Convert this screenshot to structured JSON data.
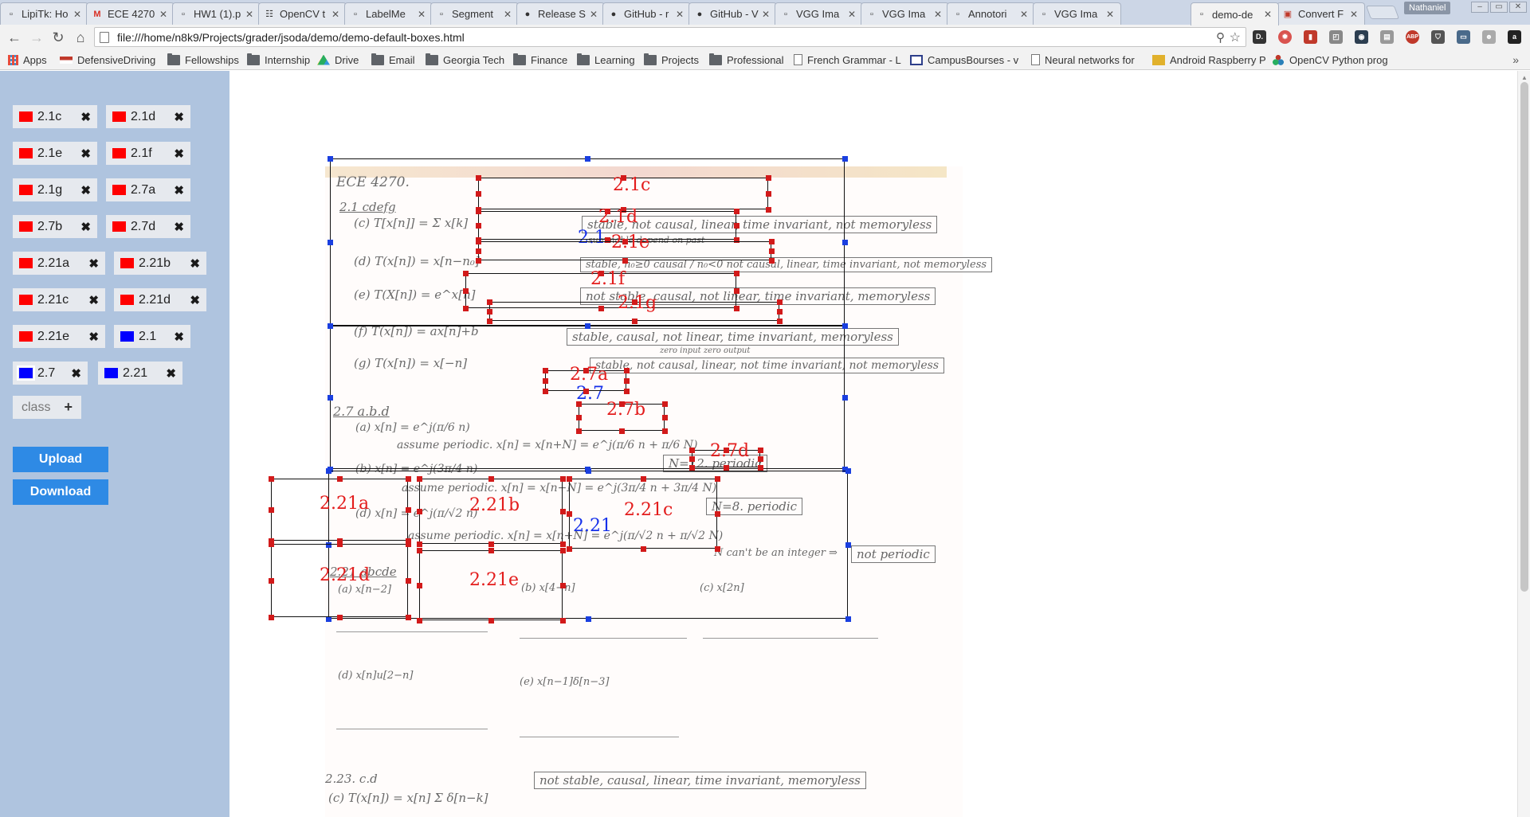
{
  "browser": {
    "tabs": [
      {
        "title": "LipiTk: Ho",
        "icon": "page"
      },
      {
        "title": "ECE 4270",
        "icon": "gmail"
      },
      {
        "title": "HW1 (1).p",
        "icon": "page"
      },
      {
        "title": "OpenCV t",
        "icon": "docs"
      },
      {
        "title": "LabelMe",
        "icon": "page"
      },
      {
        "title": "Segment",
        "icon": "page"
      },
      {
        "title": "Release S",
        "icon": "github"
      },
      {
        "title": "GitHub - r",
        "icon": "github"
      },
      {
        "title": "GitHub - V",
        "icon": "github"
      },
      {
        "title": "VGG Ima",
        "icon": "page"
      },
      {
        "title": "VGG Ima",
        "icon": "page"
      },
      {
        "title": "Annotori",
        "icon": "page"
      },
      {
        "title": "VGG Ima",
        "icon": "page"
      },
      {
        "title": "demo-de",
        "icon": "page",
        "active": true
      },
      {
        "title": "Convert F",
        "icon": "convert"
      }
    ],
    "profile_name": "Nathaniel",
    "url": "file:///home/n8k9/Projects/grader/jsoda/demo/demo-default-boxes.html",
    "bookmarks": [
      {
        "label": "Apps",
        "icon": "apps-icon"
      },
      {
        "label": "DefensiveDriving",
        "icon": "flag-icon"
      },
      {
        "label": "Fellowships",
        "icon": "folder-icon"
      },
      {
        "label": "Internship",
        "icon": "folder-icon"
      },
      {
        "label": "Drive",
        "icon": "drive-icon"
      },
      {
        "label": "Email",
        "icon": "folder-icon"
      },
      {
        "label": "Georgia Tech",
        "icon": "folder-icon"
      },
      {
        "label": "Finance",
        "icon": "folder-icon"
      },
      {
        "label": "Learning",
        "icon": "folder-icon"
      },
      {
        "label": "Projects",
        "icon": "folder-icon"
      },
      {
        "label": "Professional",
        "icon": "folder-icon"
      },
      {
        "label": "French Grammar - L",
        "icon": "page-icon"
      },
      {
        "label": "CampusBourses - v",
        "icon": "campus-icon"
      },
      {
        "label": "Neural networks for",
        "icon": "page-icon"
      },
      {
        "label": "Android Raspberry P",
        "icon": "jw-icon"
      },
      {
        "label": "OpenCV Python prog",
        "icon": "opencv-icon"
      }
    ]
  },
  "app": {
    "classes": [
      {
        "label": "2.1c",
        "color": "#ff0000"
      },
      {
        "label": "2.1d",
        "color": "#ff0000"
      },
      {
        "label": "2.1e",
        "color": "#ff0000"
      },
      {
        "label": "2.1f",
        "color": "#ff0000"
      },
      {
        "label": "2.1g",
        "color": "#ff0000"
      },
      {
        "label": "2.7a",
        "color": "#ff0000"
      },
      {
        "label": "2.7b",
        "color": "#ff0000"
      },
      {
        "label": "2.7d",
        "color": "#ff0000"
      },
      {
        "label": "2.21a",
        "color": "#ff0000"
      },
      {
        "label": "2.21b",
        "color": "#ff0000"
      },
      {
        "label": "2.21c",
        "color": "#ff0000"
      },
      {
        "label": "2.21d",
        "color": "#ff0000"
      },
      {
        "label": "2.21e",
        "color": "#ff0000"
      },
      {
        "label": "2.1",
        "color": "#0000ff"
      },
      {
        "label": "2.7",
        "color": "#0000ff",
        "selected": true
      },
      {
        "label": "2.21",
        "color": "#0000ff"
      }
    ],
    "class_input_placeholder": "class",
    "upload_label": "Upload",
    "download_label": "Download",
    "boxes": [
      {
        "label": "2.1",
        "color": "blue"
      },
      {
        "label": "2.7",
        "color": "blue"
      },
      {
        "label": "2.21",
        "color": "blue"
      },
      {
        "label": "2.1c",
        "color": "red"
      },
      {
        "label": "2.1d",
        "color": "red"
      },
      {
        "label": "2.1e",
        "color": "red"
      },
      {
        "label": "2.1f",
        "color": "red"
      },
      {
        "label": "2.1g",
        "color": "red"
      },
      {
        "label": "2.7a",
        "color": "red"
      },
      {
        "label": "2.7b",
        "color": "red"
      },
      {
        "label": "2.7d",
        "color": "red"
      },
      {
        "label": "2.21a",
        "color": "red"
      },
      {
        "label": "2.21b",
        "color": "red"
      },
      {
        "label": "2.21c",
        "color": "red"
      },
      {
        "label": "2.21d",
        "color": "red"
      },
      {
        "label": "2.21e",
        "color": "red"
      }
    ]
  },
  "homework": {
    "course": "ECE 4270.",
    "sec21": "2.1 cdefg",
    "c_eq": "(c) T[x[n]] = Σ x[k]",
    "c_ans": "stable, not causal, linear, time invariant, not memoryless",
    "c_note": "summable    depend on past",
    "d_eq": "(d) T(x[n]) = x[n−n₀]",
    "d_ans": "stable, n₀≥0 causal / n₀<0 not causal, linear, time invariant, not memoryless",
    "e_eq": "(e) T(X[n]) = e^x[n]",
    "e_ans": "not stable, causal, not linear, time invariant, memoryless",
    "f_eq": "(f) T(x[n]) = ax[n]+b",
    "f_ans": "stable, causal, not linear, time invariant, memoryless",
    "f_note": "zero input zero output",
    "g_eq": "(g) T(x[n]) = x[−n]",
    "g_ans": "stable, not causal, linear, not time invariant, not memoryless",
    "sec27": "2.7 a.b.d",
    "a7_eq": "(a) x[n] = e^j(π/6 n)",
    "a7_work": "assume periodic. x[n] = x[n+N] = e^j(π/6 n + π/6 N)",
    "a7_ans": "N=12. periodic",
    "b7_eq": "(b) x[n] = e^j(3π/4 n)",
    "b7_work": "assume periodic. x[n] = x[n+N] = e^j(3π/4 n + 3π/4 N)",
    "b7_ans": "N=8. periodic",
    "d7_eq": "(d) x[n] = e^j(π/√2 n)",
    "d7_work": "assume periodic. x[n] = x[n+N] = e^j(π/√2 n + π/√2 N)",
    "d7_note": "N can't be an integer ⇒",
    "d7_ans": "not periodic",
    "sec221": "2.21 abcde",
    "p221a": "(a) x[n−2]",
    "p221b": "(b) x[4−n]",
    "p221c": "(c) x[2n]",
    "p221d": "(d) x[n]u[2−n]",
    "p221e": "(e) x[n−1]δ[n−3]",
    "sec223": "2.23. c.d",
    "c223_eq": "(c) T(x[n]) = x[n] Σ δ[n−k]",
    "c223_ans": "not stable, causal, linear, time invariant, memoryless"
  }
}
